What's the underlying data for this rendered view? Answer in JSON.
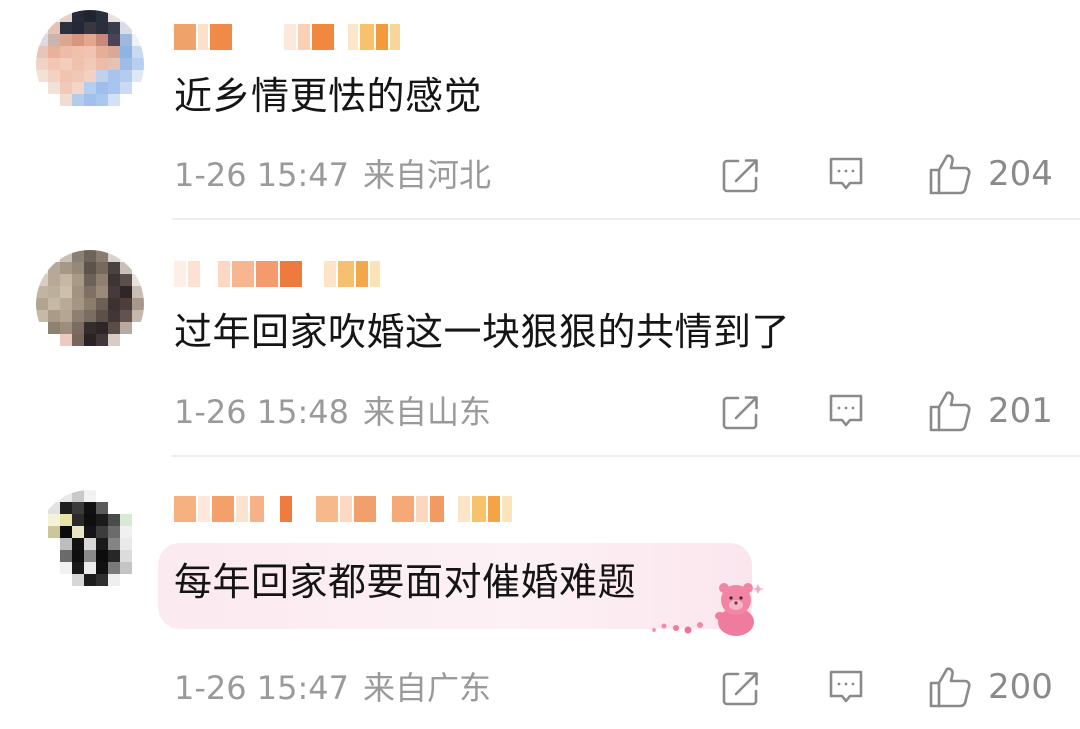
{
  "comments": [
    {
      "text": "近乡情更怯的感觉",
      "time": "1-26 15:47",
      "location": "来自河北",
      "likes": "204",
      "icons": [
        "share-icon",
        "comment-icon",
        "like-icon"
      ]
    },
    {
      "text": "过年回家吹婚这一块狠狠的共情到了",
      "time": "1-26 15:48",
      "location": "来自山东",
      "likes": "201",
      "icons": [
        "share-icon",
        "comment-icon",
        "like-icon"
      ]
    },
    {
      "text": "每年回家都要面对催婚难题",
      "time": "1-26 15:47",
      "location": "来自广东",
      "likes": "200",
      "icons": [
        "share-icon",
        "comment-icon",
        "like-icon"
      ],
      "sticker": "bear-sticker"
    }
  ]
}
